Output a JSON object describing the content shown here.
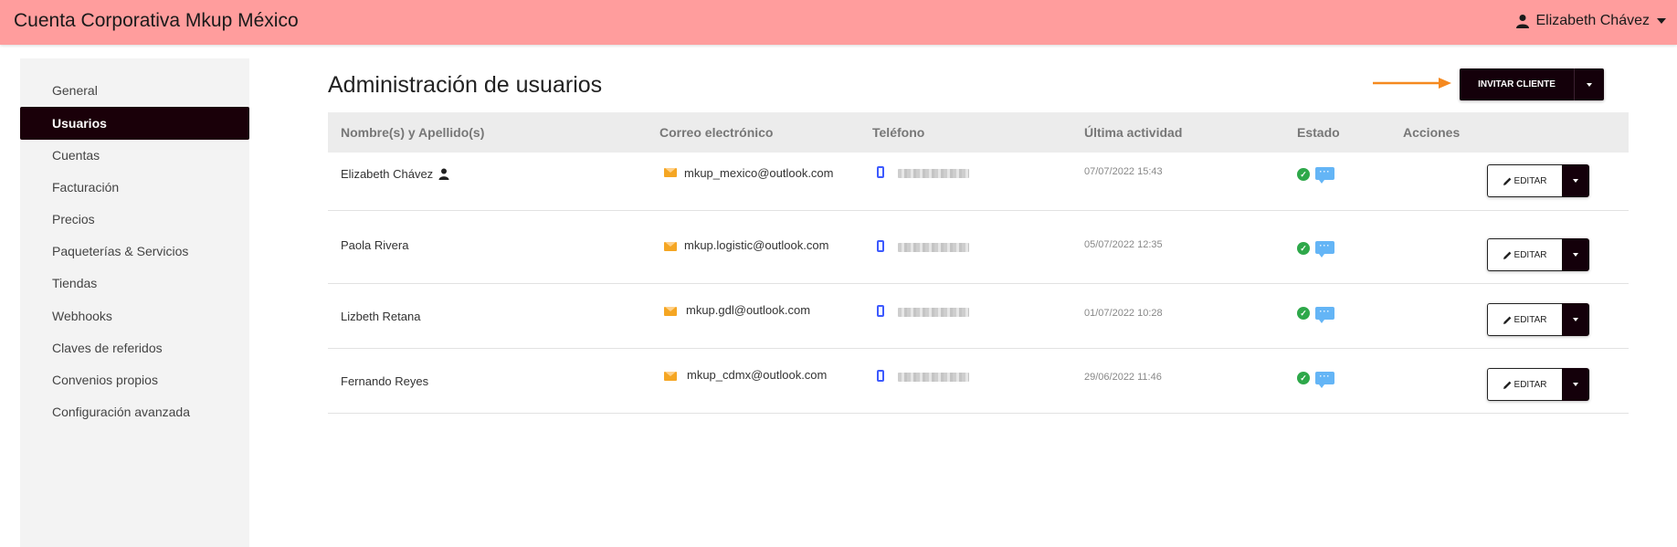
{
  "header": {
    "app_title": "Cuenta Corporativa Mkup México",
    "user_name": "Elizabeth Chávez"
  },
  "sidebar": {
    "items": [
      {
        "label": "General",
        "active": false
      },
      {
        "label": "Usuarios",
        "active": true
      },
      {
        "label": "Cuentas",
        "active": false
      },
      {
        "label": "Facturación",
        "active": false
      },
      {
        "label": "Precios",
        "active": false
      },
      {
        "label": "Paqueterías & Servicios",
        "active": false
      },
      {
        "label": "Tiendas",
        "active": false
      },
      {
        "label": "Webhooks",
        "active": false
      },
      {
        "label": "Claves de referidos",
        "active": false
      },
      {
        "label": "Convenios propios",
        "active": false
      },
      {
        "label": "Configuración avanzada",
        "active": false
      }
    ]
  },
  "main": {
    "title": "Administración de usuarios",
    "invite_button": "INVITAR CLIENTE",
    "columns": [
      "Nombre(s) y Apellido(s)",
      "Correo electrónico",
      "Teléfono",
      "Última actividad",
      "Estado",
      "Acciones"
    ],
    "rows": [
      {
        "name": "Elizabeth Chávez",
        "is_owner": true,
        "email": "mkup_mexico@outlook.com",
        "last_activity": "07/07/2022 15:43",
        "action": "EDITAR"
      },
      {
        "name": "Paola Rivera",
        "is_owner": false,
        "email": "mkup.logistic@outlook.com",
        "last_activity": "05/07/2022 12:35",
        "action": "EDITAR"
      },
      {
        "name": "Lizbeth Retana",
        "is_owner": false,
        "email": "mkup.gdl@outlook.com",
        "last_activity": "01/07/2022 10:28",
        "action": "EDITAR"
      },
      {
        "name": "Fernando Reyes",
        "is_owner": false,
        "email": "mkup_cdmx@outlook.com",
        "last_activity": "29/06/2022 11:46",
        "action": "EDITAR"
      }
    ]
  },
  "colors": {
    "topbar": "#ff9d9d",
    "dark": "#14000a",
    "sidebar_bg": "#f3f3f3",
    "accent_arrow": "#f5891f",
    "mail_icon": "#f5a623",
    "phone_icon": "#3d5afe",
    "status_ok": "#2ea84a",
    "chat_icon": "#64b5f6"
  },
  "icons": {
    "user": "person-icon",
    "mail": "envelope-icon",
    "phone": "smartphone-icon",
    "status": "check-circle-icon",
    "message": "chat-bubble-icon",
    "edit": "pencil-icon"
  }
}
